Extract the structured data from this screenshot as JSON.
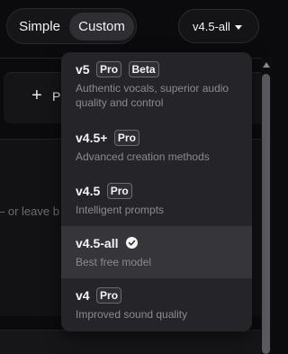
{
  "mode_toggle": {
    "options": [
      {
        "label": "Simple",
        "active": false
      },
      {
        "label": "Custom",
        "active": true
      }
    ]
  },
  "model_select": {
    "label": "v4.5-all",
    "icon": "caret-down-icon"
  },
  "background": {
    "add_button_label": "+ P",
    "hint_text": "– or leave b"
  },
  "model_menu": {
    "items": [
      {
        "name": "v5",
        "badges": [
          "Pro",
          "Beta"
        ],
        "description": "Authentic vocals, superior audio quality and control",
        "selected": false
      },
      {
        "name": "v4.5+",
        "badges": [
          "Pro"
        ],
        "description": "Advanced creation methods",
        "selected": false
      },
      {
        "name": "v4.5",
        "badges": [
          "Pro"
        ],
        "description": "Intelligent prompts",
        "selected": false
      },
      {
        "name": "v4.5-all",
        "badges": [],
        "description": "Best free model",
        "selected": true,
        "icon": "check-circle-icon"
      },
      {
        "name": "v4",
        "badges": [
          "Pro"
        ],
        "description": "Improved sound quality",
        "selected": false
      }
    ]
  },
  "colors": {
    "background": "#0b0b0d",
    "menu": "#252529",
    "selected_row": "#35353a",
    "text": "#f4f4f4",
    "muted_text": "#8a8a90"
  }
}
